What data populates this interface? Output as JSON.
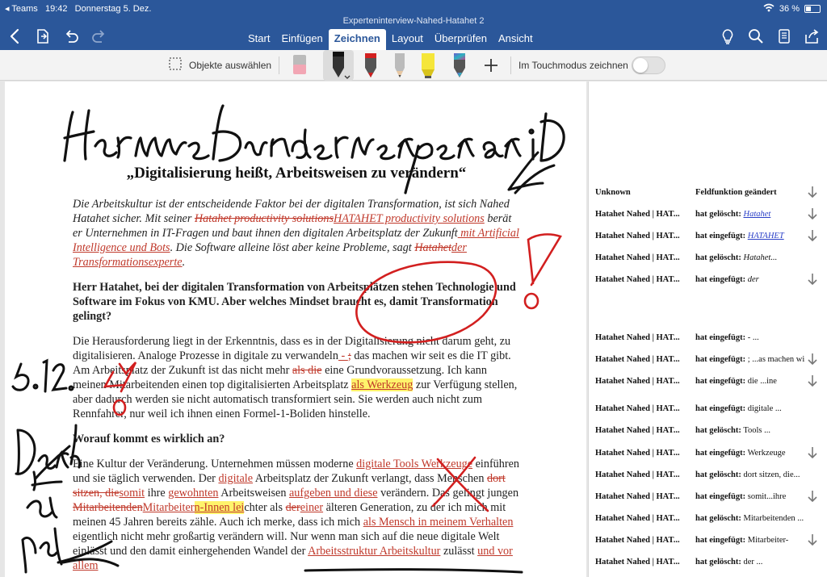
{
  "status_bar": {
    "back_app": "◂ Teams",
    "time": "19:42",
    "date": "Donnerstag 5. Dez.",
    "battery": "36 %",
    "battery_level": 0.36
  },
  "document_title": "Experteninterview-Nahed-Hatahet 2",
  "tabs": [
    {
      "label": "Start"
    },
    {
      "label": "Einfügen"
    },
    {
      "label": "Zeichnen",
      "active": true
    },
    {
      "label": "Layout"
    },
    {
      "label": "Überprüfen"
    },
    {
      "label": "Ansicht"
    }
  ],
  "toolbar_icons": [
    "back-icon",
    "file-icon",
    "undo-icon",
    "redo-icon",
    "lightbulb-icon",
    "search-icon",
    "reading-view-icon",
    "share-icon"
  ],
  "ribbon": {
    "select_objects": "Objekte auswählen",
    "touch_mode": "Im Touchmodus zeichnen",
    "touch_mode_on": false,
    "tools": [
      "eraser",
      "pen-black",
      "pen-red",
      "pencil",
      "highlighter-yellow",
      "pen-galaxy"
    ]
  },
  "colors": {
    "accent": "#2b579a",
    "revision": "#c0392b",
    "ink_red": "#d21f1f",
    "highlight": "#fff36b"
  },
  "document": {
    "title": "„Digitalisierung heißt, Arbeitsweisen zu verändern“",
    "lead": {
      "t1": "Die Arbeitskultur ist der entscheidende Faktor bei der digitalen Transformation, ist sich Nahed Hatahet sicher. Mit seiner ",
      "del1": "Hatahet productivity solutions",
      "ins1": "HATAHET productivity solutions",
      "t2": " berät er Unternehmen in IT-Fragen und baut ihnen den digitalen Arbeitsplatz der Zukunft",
      "ins2": " mit Artificial Intelligence und Bots",
      "t3": ". Die Software alleine löst aber keine Probleme, sagt ",
      "del2": "Hatahet",
      "ins3": "der Transformationsexperte",
      "t4": "."
    },
    "question1": "Herr Hatahet, bei der digitalen Transformation von Arbeitsplätzen stehen Technologie und Software im Fokus von KMU. Aber welches Mindset braucht es, damit Transformation gelingt?",
    "para1": {
      "t1": "Die Herausforderung liegt in der Erkenntnis, dass es in der Digitalisierung nicht darum geht, zu digitalisieren. Analoge Prozesse in digitale zu verwandeln",
      "ins1": " - ",
      "del1": ";",
      "t2": " das machen wir seit es die IT gibt. Am Arbeitsplatz der Zukunft ist das nicht mehr ",
      "del2": "als die",
      "t3": " eine Grundvoraussetzung. Ich kann meinen Mitarbeitenden einen top digitalisierten Arbeitsplatz ",
      "ins2": "als Werkzeug",
      "t4": " zur Verfügung stellen, aber dadurch werden sie nicht automatisch transformiert sein. Sie werden auch nicht zum Rennfahrer, nur weil ich ihnen einen Formel-1-Boliden hinstelle."
    },
    "question2": "Worauf kommt es wirklich an?",
    "para2": {
      "t1": "Eine Kultur der Veränderung. Unternehmen müssen moderne ",
      "ins1": "digitale Tools Werkzeuge",
      "t2": " einführen und sie täglich verwenden. Der ",
      "ins2": "digitale",
      "t3": " Arbeitsplatz der Zukunft verlangt, dass Menschen ",
      "del1": "dort sitzen, die",
      "ins3": "somit",
      "t4": " ihre ",
      "ins4": "gewohnten",
      "t5": " Arbeitsweisen ",
      "ins5": "aufgeben und diese",
      "t6": " verändern. Das gelingt jungen ",
      "del2": "Mitarbeitenden",
      "ins6": "Mitarbeiter",
      "ins7": "n-Innen",
      "ins8": " lei",
      "t7": "chter als ",
      "del3": "der",
      "ins9": "einer",
      "t8": " älteren Generation, zu der ich mich mit meinen 45 Jahren bereits zähle. Auch ich merke, dass ich mich ",
      "ins10": "als Mensch in meinem Verhalten",
      "t9": " eigentlich nicht mehr großartig verändern will. Nur wenn man sich auf die neue digitale Welt einlässt und den damit einhergehenden Wandel der ",
      "ins11": "Arbeitsstruktur Arbeitskultur",
      "t10": " zulässt ",
      "ins12": "und vor allem"
    }
  },
  "markup_pane": {
    "header": {
      "author": "Unknown",
      "action": "Feldfunktion geändert"
    },
    "rows": [
      {
        "author": "Hatahet Nahed | HAT...",
        "action": "hat gelöscht:",
        "detail": "Hatahet",
        "style": "link",
        "arrow": true
      },
      {
        "author": "Hatahet Nahed | HAT...",
        "action": "hat eingefügt:",
        "detail": "HATAHET",
        "style": "link",
        "arrow": true
      },
      {
        "author": "Hatahet Nahed | HAT...",
        "action": "hat gelöscht:",
        "detail": "Hatahet...",
        "style": "italic",
        "arrow": false
      },
      {
        "author": "Hatahet Nahed | HAT...",
        "action": "hat eingefügt:",
        "detail": "der",
        "style": "italic",
        "arrow": true
      },
      {
        "author": "Hatahet Nahed | HAT...",
        "action": "hat eingefügt:",
        "detail": " - ...",
        "style": "plain",
        "arrow": false
      },
      {
        "author": "Hatahet Nahed | HAT...",
        "action": "hat eingefügt:",
        "detail": "; ...as machen wi",
        "style": "plain",
        "arrow": true
      },
      {
        "author": "Hatahet Nahed | HAT...",
        "action": "hat eingefügt:",
        "detail": "die ...ine",
        "style": "plain",
        "arrow": true
      },
      {
        "author": "Hatahet Nahed | HAT...",
        "action": "hat eingefügt:",
        "detail": "digitale ...",
        "style": "plain",
        "arrow": false
      },
      {
        "author": "Hatahet Nahed | HAT...",
        "action": "hat gelöscht:",
        "detail": "Tools ...",
        "style": "plain",
        "arrow": false
      },
      {
        "author": "Hatahet Nahed | HAT...",
        "action": "hat eingefügt:",
        "detail": "Werkzeuge",
        "style": "plain",
        "arrow": true
      },
      {
        "author": "Hatahet Nahed | HAT...",
        "action": "hat gelöscht:",
        "detail": "dort sitzen, die...",
        "style": "plain",
        "arrow": false
      },
      {
        "author": "Hatahet Nahed | HAT...",
        "action": "hat eingefügt:",
        "detail": "somit...ihre",
        "style": "plain",
        "arrow": true
      },
      {
        "author": "Hatahet Nahed | HAT...",
        "action": "hat gelöscht:",
        "detail": "Mitarbeitenden ...",
        "style": "plain",
        "arrow": false
      },
      {
        "author": "Hatahet Nahed | HAT...",
        "action": "hat eingefügt:",
        "detail": "Mitarbeiter-",
        "style": "plain",
        "arrow": true
      },
      {
        "author": "Hatahet Nahed | HAT...",
        "action": "hat gelöscht:",
        "detail": "der ...",
        "style": "plain",
        "arrow": false
      }
    ]
  },
  "handwriting": {
    "top": "Hier meine Anmerkungen am iPad",
    "left_date": "5.12.",
    "left_thanks": "Danke an Nahed"
  }
}
